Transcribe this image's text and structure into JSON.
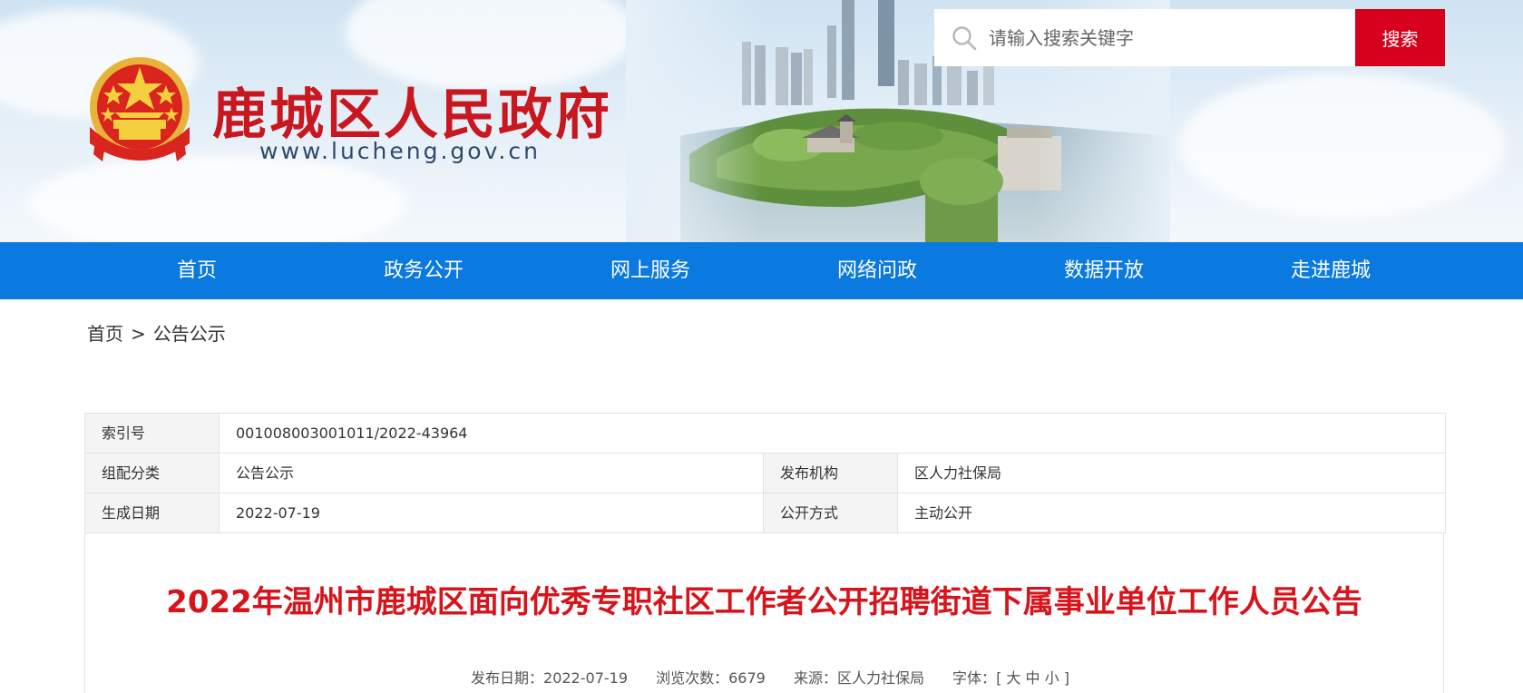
{
  "site": {
    "title": "鹿城区人民政府",
    "url": "www.lucheng.gov.cn"
  },
  "search": {
    "placeholder": "请输入搜索关键字",
    "button_label": "搜索"
  },
  "nav": {
    "items": [
      {
        "label": "首页"
      },
      {
        "label": "政务公开"
      },
      {
        "label": "网上服务"
      },
      {
        "label": "网络问政"
      },
      {
        "label": "数据开放"
      },
      {
        "label": "走进鹿城"
      }
    ]
  },
  "breadcrumb": {
    "home": "首页",
    "separator": ">",
    "current": "公告公示"
  },
  "meta": {
    "index_label": "索引号",
    "index_value": "001008003001011/2022-43964",
    "category_label": "组配分类",
    "category_value": "公告公示",
    "publisher_label": "发布机构",
    "publisher_value": "区人力社保局",
    "date_label": "生成日期",
    "date_value": "2022-07-19",
    "method_label": "公开方式",
    "method_value": "主动公开"
  },
  "article": {
    "title": "2022年温州市鹿城区面向优秀专职社区工作者公开招聘街道下属事业单位工作人员公告",
    "publish_date": "发布日期：2022-07-19",
    "views": "浏览次数：6679",
    "source": "来源：区人力社保局",
    "font_label": "字体：",
    "font_open": "[",
    "font_large": "大",
    "font_medium": "中",
    "font_small": "小",
    "font_close": "]"
  },
  "colors": {
    "nav_bg": "#0a79e0",
    "accent_red": "#d7001c",
    "title_red": "#d7141c"
  }
}
